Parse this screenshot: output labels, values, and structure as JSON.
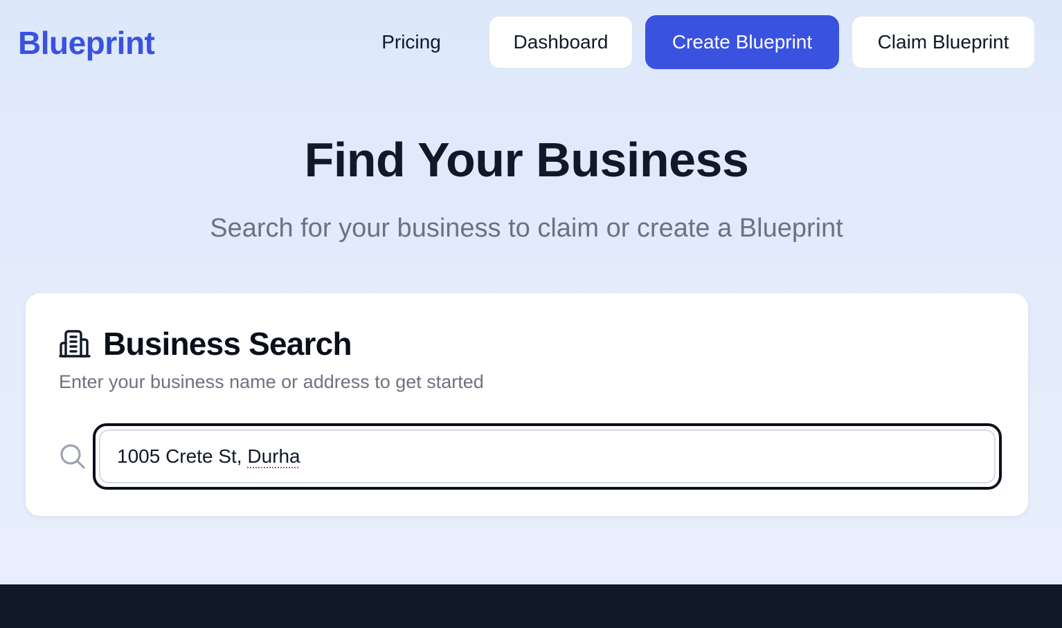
{
  "header": {
    "logo": "Blueprint",
    "nav": {
      "pricing": "Pricing",
      "dashboard": "Dashboard",
      "create": "Create Blueprint",
      "claim": "Claim Blueprint"
    }
  },
  "hero": {
    "title": "Find Your Business",
    "subtitle": "Search for your business to claim or create a Blueprint"
  },
  "search_card": {
    "icon": "building-icon",
    "title": "Business Search",
    "description": "Enter your business name or address to get started",
    "search_icon": "search-icon",
    "input_value_plain": "1005 Crete St, ",
    "input_value_misspelled": "Durha"
  },
  "colors": {
    "brand": "#3a52e0",
    "text_dark": "#111827",
    "text_muted": "#6b7280",
    "footer": "#111827",
    "background": "#e4ecfb"
  }
}
